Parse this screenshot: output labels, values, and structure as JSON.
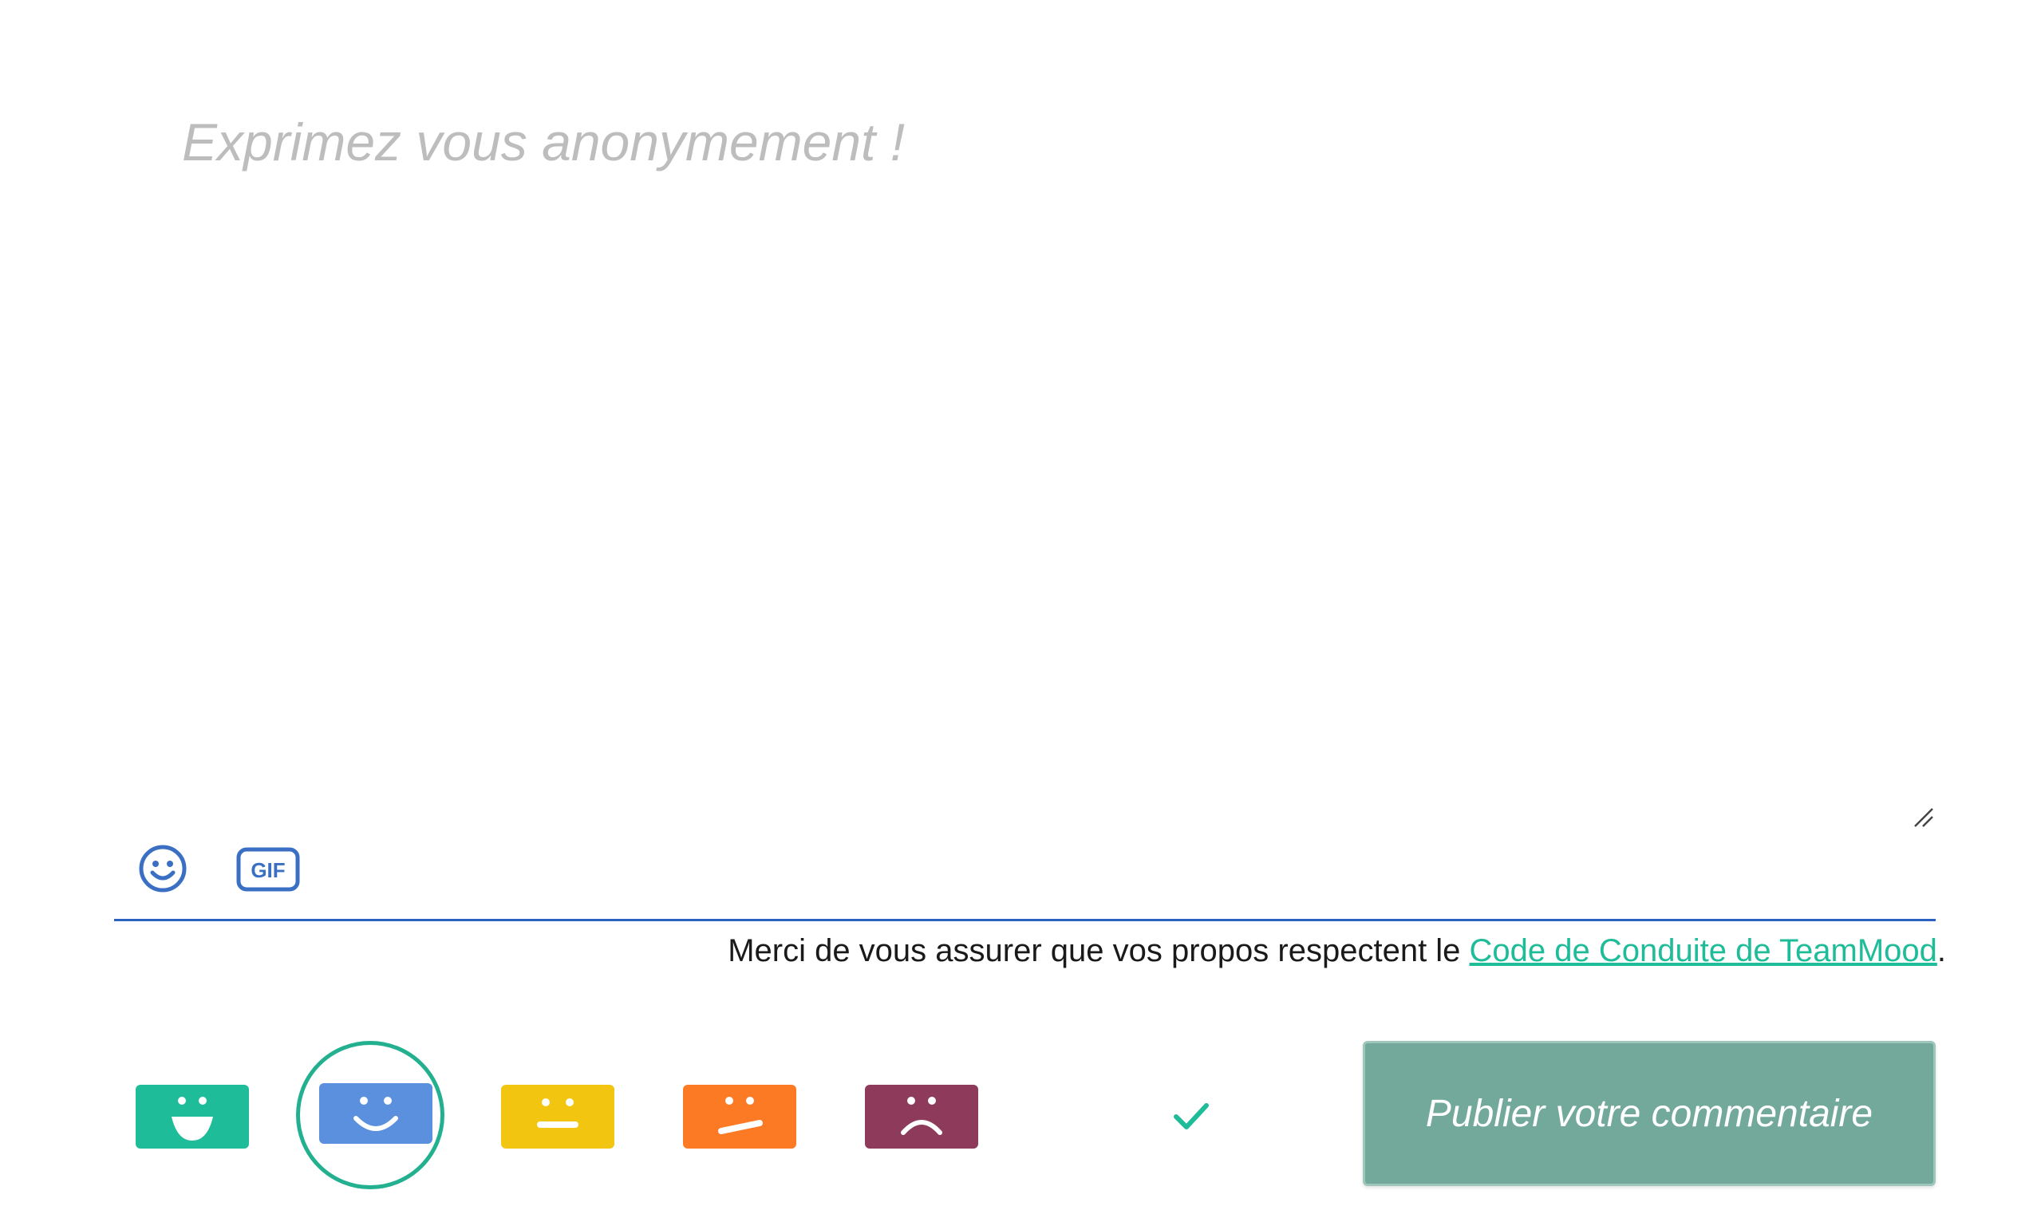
{
  "composer": {
    "placeholder": "Exprimez vous anonymement !",
    "value": ""
  },
  "toolbar": {
    "emoji_icon": "smiley-face-icon",
    "gif_icon": "gif-icon",
    "gif_label": "GIF"
  },
  "guidelines": {
    "text": "Merci de vous assurer que vos propos respectent le ",
    "link_text": "Code de Conduite de TeamMood",
    "suffix": "."
  },
  "moods": [
    {
      "id": "very-happy",
      "color": "#1ebc98",
      "icon": "big-smile-face-icon",
      "selected": false
    },
    {
      "id": "happy",
      "color": "#5b90df",
      "icon": "smile-face-icon",
      "selected": true
    },
    {
      "id": "neutral",
      "color": "#f2c511",
      "icon": "neutral-face-icon",
      "selected": false
    },
    {
      "id": "unhappy",
      "color": "#fc7a24",
      "icon": "unhappy-face-icon",
      "selected": false
    },
    {
      "id": "sad",
      "color": "#8e3a5b",
      "icon": "sad-face-icon",
      "selected": false
    }
  ],
  "publish": {
    "label": "Publier votre commentaire",
    "color": "#72a99b"
  },
  "colors": {
    "accent": "#1ebc98",
    "underline": "#2b62c2",
    "icon_blue": "#3a6fc4"
  }
}
